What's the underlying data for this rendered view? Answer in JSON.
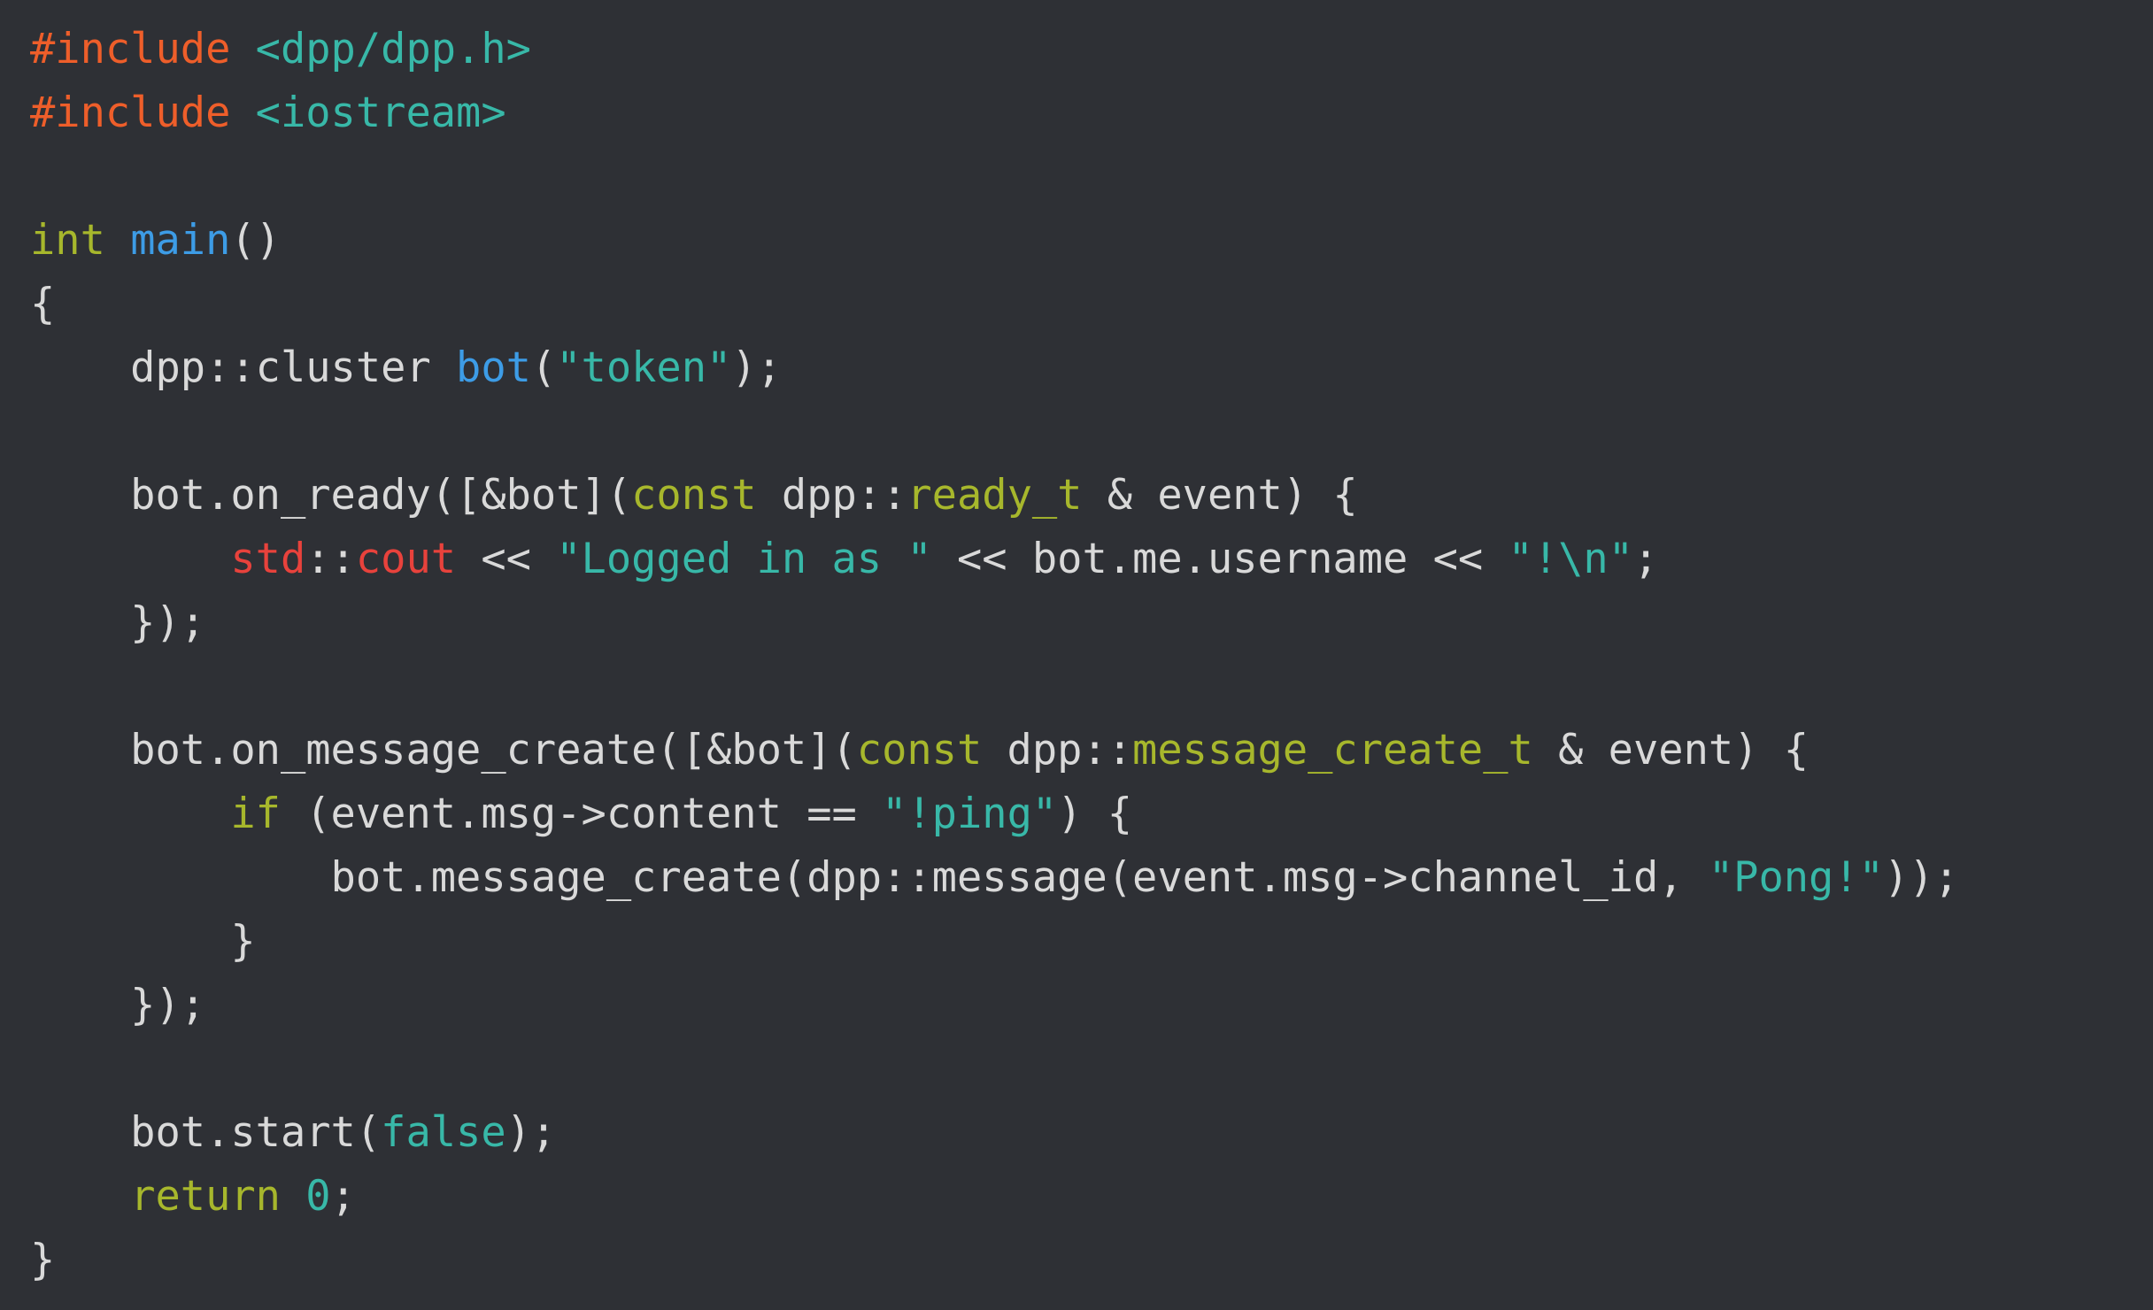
{
  "editor": {
    "language": "C++",
    "background": "#2e3035",
    "colors": {
      "directive": "#ee5e2a",
      "header": "#38b8a8",
      "type": "#a7b72c",
      "func": "#3d9ce6",
      "plain": "#d9d9d9",
      "string": "#38b8a8",
      "std": "#e8423c",
      "keyword": "#a7b72c",
      "literal": "#38b8a8"
    },
    "lines": [
      [
        {
          "t": "#include",
          "c": "directive"
        },
        {
          "t": " ",
          "c": "plain"
        },
        {
          "t": "<dpp/dpp.h>",
          "c": "header"
        }
      ],
      [
        {
          "t": "#include",
          "c": "directive"
        },
        {
          "t": " ",
          "c": "plain"
        },
        {
          "t": "<iostream>",
          "c": "header"
        }
      ],
      [],
      [
        {
          "t": "int",
          "c": "type"
        },
        {
          "t": " ",
          "c": "plain"
        },
        {
          "t": "main",
          "c": "func"
        },
        {
          "t": "()",
          "c": "plain"
        }
      ],
      [
        {
          "t": "{",
          "c": "plain"
        }
      ],
      [
        {
          "t": "    dpp::cluster ",
          "c": "plain"
        },
        {
          "t": "bot",
          "c": "func"
        },
        {
          "t": "(",
          "c": "plain"
        },
        {
          "t": "\"token\"",
          "c": "string"
        },
        {
          "t": ");",
          "c": "plain"
        }
      ],
      [],
      [
        {
          "t": "    bot.on_ready([&bot](",
          "c": "plain"
        },
        {
          "t": "const",
          "c": "type"
        },
        {
          "t": " dpp::",
          "c": "plain"
        },
        {
          "t": "ready_t",
          "c": "type"
        },
        {
          "t": " & event) {",
          "c": "plain"
        }
      ],
      [
        {
          "t": "        ",
          "c": "plain"
        },
        {
          "t": "std",
          "c": "std"
        },
        {
          "t": "::",
          "c": "plain"
        },
        {
          "t": "cout",
          "c": "std"
        },
        {
          "t": " << ",
          "c": "plain"
        },
        {
          "t": "\"Logged in as \"",
          "c": "string"
        },
        {
          "t": " << bot.me.username << ",
          "c": "plain"
        },
        {
          "t": "\"!\\n\"",
          "c": "string"
        },
        {
          "t": ";",
          "c": "plain"
        }
      ],
      [
        {
          "t": "    });",
          "c": "plain"
        }
      ],
      [],
      [
        {
          "t": "    bot.on_message_create([&bot](",
          "c": "plain"
        },
        {
          "t": "const",
          "c": "type"
        },
        {
          "t": " dpp::",
          "c": "plain"
        },
        {
          "t": "message_create_t",
          "c": "type"
        },
        {
          "t": " & event) {",
          "c": "plain"
        }
      ],
      [
        {
          "t": "        ",
          "c": "plain"
        },
        {
          "t": "if",
          "c": "keyword"
        },
        {
          "t": " (event.msg->content == ",
          "c": "plain"
        },
        {
          "t": "\"!ping\"",
          "c": "string"
        },
        {
          "t": ") {",
          "c": "plain"
        }
      ],
      [
        {
          "t": "            bot.message_create(dpp::message(event.msg->channel_id, ",
          "c": "plain"
        },
        {
          "t": "\"Pong!\"",
          "c": "string"
        },
        {
          "t": "));",
          "c": "plain"
        }
      ],
      [
        {
          "t": "        }",
          "c": "plain"
        }
      ],
      [
        {
          "t": "    });",
          "c": "plain"
        }
      ],
      [],
      [
        {
          "t": "    bot.start(",
          "c": "plain"
        },
        {
          "t": "false",
          "c": "literal"
        },
        {
          "t": ");",
          "c": "plain"
        }
      ],
      [
        {
          "t": "    ",
          "c": "plain"
        },
        {
          "t": "return",
          "c": "keyword"
        },
        {
          "t": " ",
          "c": "plain"
        },
        {
          "t": "0",
          "c": "literal"
        },
        {
          "t": ";",
          "c": "plain"
        }
      ],
      [
        {
          "t": "}",
          "c": "plain"
        }
      ]
    ]
  }
}
